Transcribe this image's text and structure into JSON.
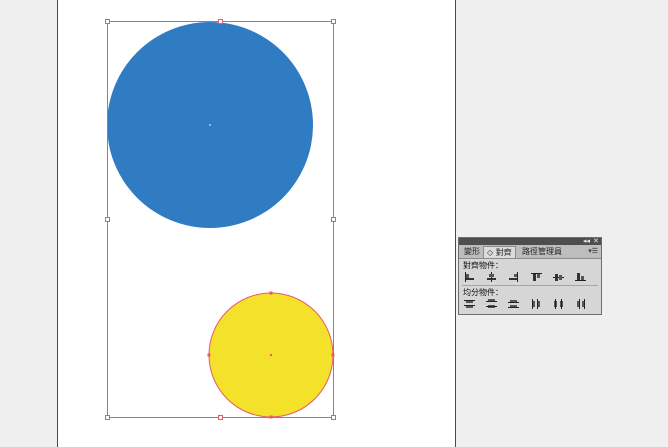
{
  "colors": {
    "canvas_bg": "#efefef",
    "artboard_bg": "#ffffff",
    "blue_circle": "#2f7cc3",
    "yellow_circle": "#f3e229",
    "selection": "#e65a6a",
    "panel_bg": "#d6d6d6"
  },
  "panel": {
    "tabs": [
      {
        "label": "變形",
        "active": false
      },
      {
        "label": "◇ 對齊",
        "active": true
      },
      {
        "label": "路徑管理員",
        "active": false
      }
    ],
    "collapse_icon": "double-chevron-icon",
    "close_icon": "close-icon",
    "menu_icon": "panel-menu-icon",
    "align_objects_label": "對齊物件：",
    "distribute_objects_label": "均分物件：",
    "align_buttons": [
      "align-left-icon",
      "align-horizontal-center-icon",
      "align-right-icon",
      "align-top-icon",
      "align-vertical-center-icon",
      "align-bottom-icon"
    ],
    "distribute_buttons": [
      "distribute-top-icon",
      "distribute-vertical-center-icon",
      "distribute-bottom-icon",
      "distribute-left-icon",
      "distribute-horizontal-center-icon",
      "distribute-right-icon"
    ]
  }
}
